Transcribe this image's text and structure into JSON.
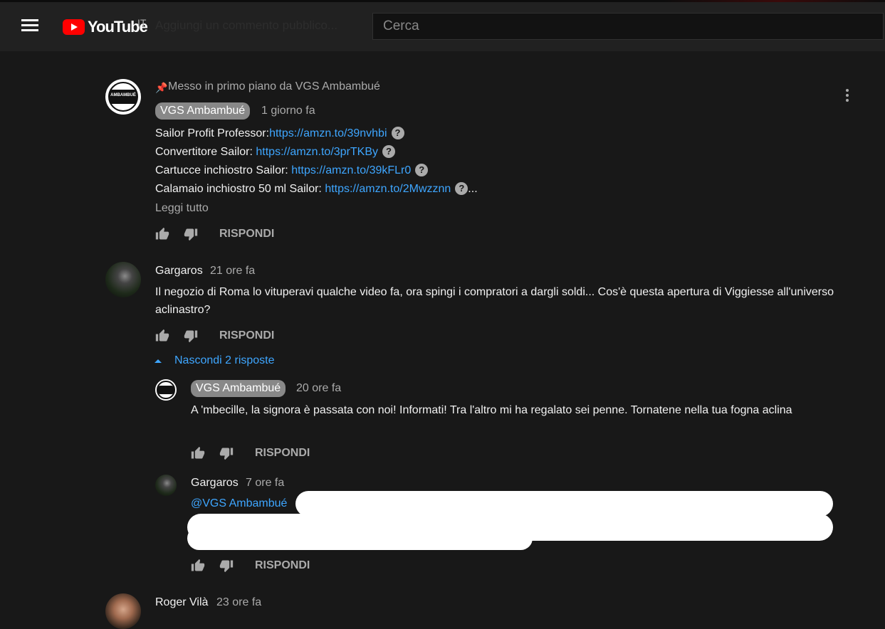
{
  "header": {
    "logo_text": "YouTube",
    "country_code": "IT",
    "ghost_text": "Aggiungi un commento pubblico...",
    "search_placeholder": "Cerca"
  },
  "comments": [
    {
      "pinned_label": "Messo in primo piano da VGS Ambambué",
      "author": "VGS Ambambué",
      "time": "1 giorno fa",
      "avatar_text": "AMBAMBUÉ",
      "lines": [
        {
          "text": "Sailor Profit Professor:",
          "link": "https://amzn.to/39nvhbi",
          "suffix": ""
        },
        {
          "text": "Convertitore Sailor: ",
          "link": "https://amzn.to/3prTKBy",
          "suffix": ""
        },
        {
          "text": "Cartucce inchiostro Sailor: ",
          "link": "https://amzn.to/39kFLr0",
          "suffix": ""
        },
        {
          "text": "Calamaio inchiostro 50 ml Sailor: ",
          "link": "https://amzn.to/2Mwzznn",
          "suffix": "..."
        }
      ],
      "read_more": "Leggi tutto",
      "reply_label": "RISPONDI"
    },
    {
      "author": "Gargaros",
      "time": "21 ore fa",
      "text": "Il negozio di Roma lo vituperavi qualche video fa, ora spingi i compratori a dargli soldi... Cos'è questa apertura di Viggiesse all'universo aclinastro?",
      "reply_label": "RISPONDI",
      "hide_replies": "Nascondi 2 risposte",
      "replies": [
        {
          "author": "VGS Ambambué",
          "time": "20 ore fa",
          "text": "A 'mbecille, la signora è passata con noi! Informati! Tra l'altro mi ha regalato sei penne. Tornatene nella tua fogna aclina",
          "reply_label": "RISPONDI"
        },
        {
          "author": "Gargaros",
          "time": "7 ore fa",
          "mention": "@VGS Ambambué",
          "reply_label": "RISPONDI"
        }
      ]
    },
    {
      "author": "Roger Vilà",
      "time": "23 ore fa"
    }
  ],
  "colors": {
    "link": "#3ea6ff",
    "background": "#181818",
    "badge": "#888888"
  }
}
